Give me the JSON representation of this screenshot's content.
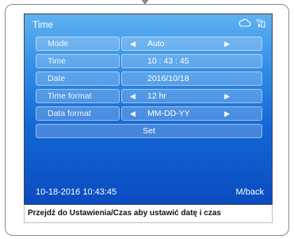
{
  "screen": {
    "title": "Time",
    "status_icons": [
      "cloud-icon",
      "wifi-phone-icon"
    ],
    "rows": [
      {
        "label": "Mode",
        "value": "Auto",
        "arrows": true
      },
      {
        "label": "Time",
        "value": "10 : 43 : 45",
        "arrows": false
      },
      {
        "label": "Date",
        "value": "2016/10/18",
        "arrows": false
      },
      {
        "label": "Time format",
        "value": "12 hr",
        "arrows": true
      },
      {
        "label": "Data format",
        "value": "MM-DD-YY",
        "arrows": true
      }
    ],
    "set_label": "Set",
    "footer_datetime": "10-18-2016 10:43:45",
    "back_label": "M/back"
  },
  "caption": "Przejdź do Ustawienia/Czas aby ustawić datę i czas",
  "colors": {
    "screen_top": "#5fb1f1",
    "screen_bottom": "#0b4cc0"
  }
}
